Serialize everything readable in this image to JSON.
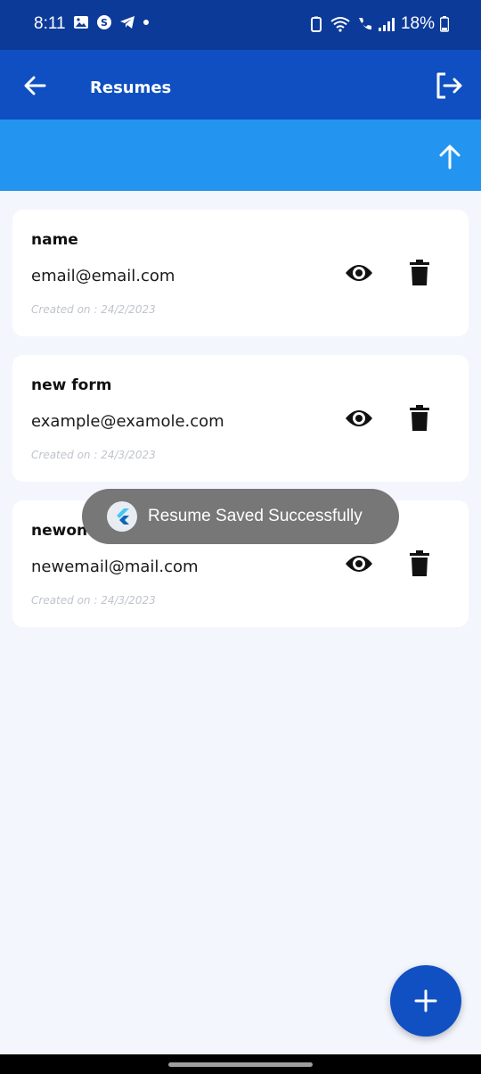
{
  "status_bar": {
    "time": "8:11",
    "battery": "18%"
  },
  "app_bar": {
    "title": "Resumes"
  },
  "resumes": [
    {
      "name": "name",
      "email": "email@email.com",
      "created": "Created on : 24/2/2023"
    },
    {
      "name": "new form",
      "email": "example@examole.com",
      "created": "Created on : 24/3/2023"
    },
    {
      "name": "newone",
      "email": "newemail@mail.com",
      "created": "Created on : 24/3/2023"
    }
  ],
  "toast": {
    "message": "Resume Saved Successfully"
  },
  "colors": {
    "status_bar": "#0b3a99",
    "app_bar": "#0f4fc1",
    "upload_bar": "#2395f1",
    "background": "#f3f6fd",
    "fab": "#1150c3"
  },
  "icons": {
    "back": "arrow-left-icon",
    "logout": "logout-icon",
    "upload": "arrow-up-icon",
    "view": "eye-icon",
    "delete": "trash-icon",
    "add": "plus-icon"
  }
}
